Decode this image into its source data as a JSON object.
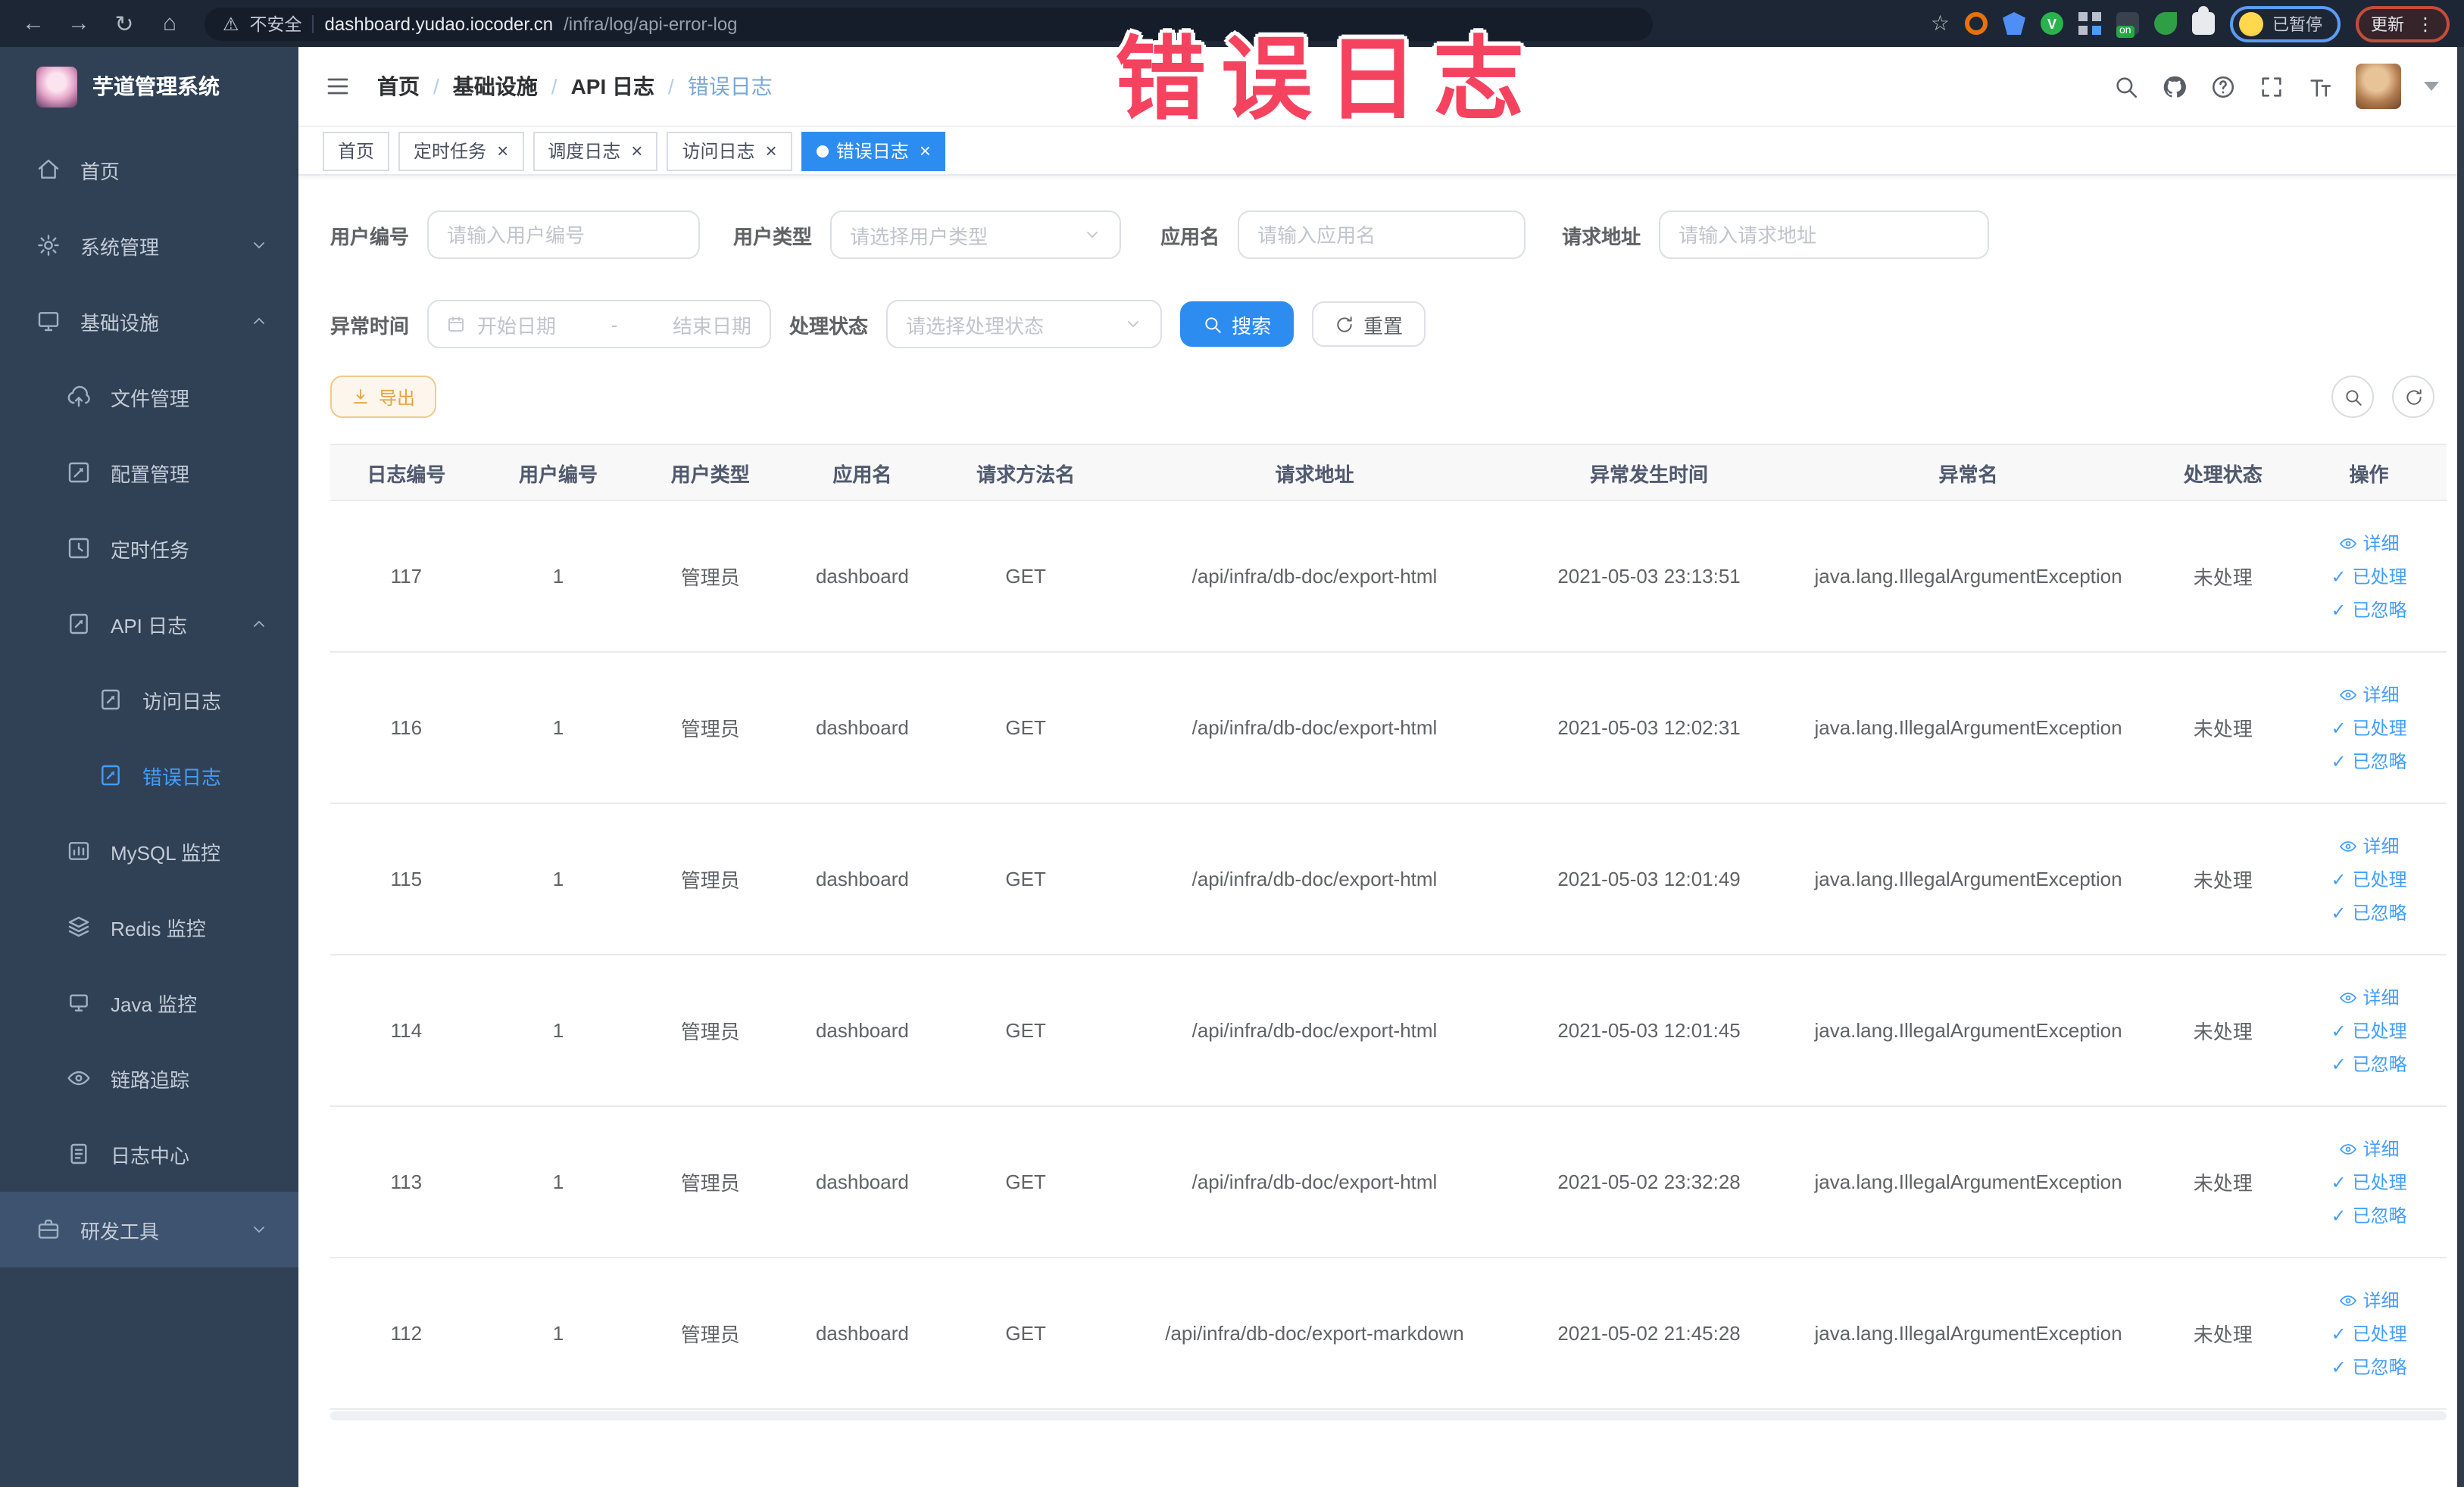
{
  "colors": {
    "primary": "#409eff",
    "active_tab": "#2d8cf0",
    "sidebar_bg": "#304156",
    "overlay_red": "#f4425f",
    "warning_orange": "#e6a23c"
  },
  "browser": {
    "security_label": "不安全",
    "url_host": "dashboard.yudao.iocoder.cn",
    "url_path": "/infra/log/api-error-log",
    "paused_badge": "已暂停",
    "update_button": "更新"
  },
  "overlay": {
    "text": "错误日志"
  },
  "sidebar": {
    "title": "芋道管理系统",
    "items": [
      {
        "label": "首页",
        "icon": "home-icon",
        "level": 0,
        "chevron": null,
        "active": false,
        "highlight": false
      },
      {
        "label": "系统管理",
        "icon": "gear-icon",
        "level": 0,
        "chevron": "down",
        "active": false,
        "highlight": false
      },
      {
        "label": "基础设施",
        "icon": "monitor-icon",
        "level": 0,
        "chevron": "up",
        "active": false,
        "highlight": false
      },
      {
        "label": "文件管理",
        "icon": "cloud-upload-icon",
        "level": 1,
        "chevron": null,
        "active": false,
        "highlight": false
      },
      {
        "label": "配置管理",
        "icon": "edit-icon",
        "level": 1,
        "chevron": null,
        "active": false,
        "highlight": false
      },
      {
        "label": "定时任务",
        "icon": "clock-icon",
        "level": 1,
        "chevron": null,
        "active": false,
        "highlight": false
      },
      {
        "label": "API 日志",
        "icon": "doc-edit-icon",
        "level": 1,
        "chevron": "up",
        "active": false,
        "highlight": false
      },
      {
        "label": "访问日志",
        "icon": "doc-edit-icon",
        "level": 2,
        "chevron": null,
        "active": false,
        "highlight": false
      },
      {
        "label": "错误日志",
        "icon": "doc-edit-icon",
        "level": 2,
        "chevron": null,
        "active": true,
        "highlight": false
      },
      {
        "label": "MySQL 监控",
        "icon": "chart-icon",
        "level": 1,
        "chevron": null,
        "active": false,
        "highlight": false
      },
      {
        "label": "Redis 监控",
        "icon": "layers-icon",
        "level": 1,
        "chevron": null,
        "active": false,
        "highlight": false
      },
      {
        "label": "Java 监控",
        "icon": "java-monitor-icon",
        "level": 1,
        "chevron": null,
        "active": false,
        "highlight": false
      },
      {
        "label": "链路追踪",
        "icon": "eye-icon",
        "level": 1,
        "chevron": null,
        "active": false,
        "highlight": false
      },
      {
        "label": "日志中心",
        "icon": "doc-icon",
        "level": 1,
        "chevron": null,
        "active": false,
        "highlight": false
      },
      {
        "label": "研发工具",
        "icon": "briefcase-icon",
        "level": 0,
        "chevron": "down",
        "active": false,
        "highlight": true
      }
    ]
  },
  "breadcrumb": [
    "首页",
    "基础设施",
    "API 日志",
    "错误日志"
  ],
  "tabs": [
    {
      "label": "首页",
      "closable": false,
      "active": false
    },
    {
      "label": "定时任务",
      "closable": true,
      "active": false
    },
    {
      "label": "调度日志",
      "closable": true,
      "active": false
    },
    {
      "label": "访问日志",
      "closable": true,
      "active": false
    },
    {
      "label": "错误日志",
      "closable": true,
      "active": true
    }
  ],
  "filters": {
    "user_id": {
      "label": "用户编号",
      "placeholder": "请输入用户编号"
    },
    "user_type": {
      "label": "用户类型",
      "placeholder": "请选择用户类型"
    },
    "app_name": {
      "label": "应用名",
      "placeholder": "请输入应用名"
    },
    "request_url": {
      "label": "请求地址",
      "placeholder": "请输入请求地址"
    },
    "exception_time": {
      "label": "异常时间",
      "start_placeholder": "开始日期",
      "separator": "-",
      "end_placeholder": "结束日期"
    },
    "process_status": {
      "label": "处理状态",
      "placeholder": "请选择处理状态"
    },
    "search_button": "搜索",
    "reset_button": "重置"
  },
  "toolbar": {
    "export_button": "导出"
  },
  "table": {
    "columns": [
      "日志编号",
      "用户编号",
      "用户类型",
      "应用名",
      "请求方法名",
      "请求地址",
      "异常发生时间",
      "异常名",
      "处理状态",
      "操作"
    ],
    "actions": [
      "详细",
      "已处理",
      "已忽略"
    ],
    "rows": [
      {
        "id": "117",
        "user_id": "1",
        "user_type": "管理员",
        "app": "dashboard",
        "method": "GET",
        "url": "/api/infra/db-doc/export-html",
        "time": "2021-05-03 23:13:51",
        "exception": "java.lang.IllegalArgumentException",
        "status": "未处理"
      },
      {
        "id": "116",
        "user_id": "1",
        "user_type": "管理员",
        "app": "dashboard",
        "method": "GET",
        "url": "/api/infra/db-doc/export-html",
        "time": "2021-05-03 12:02:31",
        "exception": "java.lang.IllegalArgumentException",
        "status": "未处理"
      },
      {
        "id": "115",
        "user_id": "1",
        "user_type": "管理员",
        "app": "dashboard",
        "method": "GET",
        "url": "/api/infra/db-doc/export-html",
        "time": "2021-05-03 12:01:49",
        "exception": "java.lang.IllegalArgumentException",
        "status": "未处理"
      },
      {
        "id": "114",
        "user_id": "1",
        "user_type": "管理员",
        "app": "dashboard",
        "method": "GET",
        "url": "/api/infra/db-doc/export-html",
        "time": "2021-05-03 12:01:45",
        "exception": "java.lang.IllegalArgumentException",
        "status": "未处理"
      },
      {
        "id": "113",
        "user_id": "1",
        "user_type": "管理员",
        "app": "dashboard",
        "method": "GET",
        "url": "/api/infra/db-doc/export-html",
        "time": "2021-05-02 23:32:28",
        "exception": "java.lang.IllegalArgumentException",
        "status": "未处理"
      },
      {
        "id": "112",
        "user_id": "1",
        "user_type": "管理员",
        "app": "dashboard",
        "method": "GET",
        "url": "/api/infra/db-doc/export-markdown",
        "time": "2021-05-02 21:45:28",
        "exception": "java.lang.IllegalArgumentException",
        "status": "未处理"
      }
    ]
  }
}
